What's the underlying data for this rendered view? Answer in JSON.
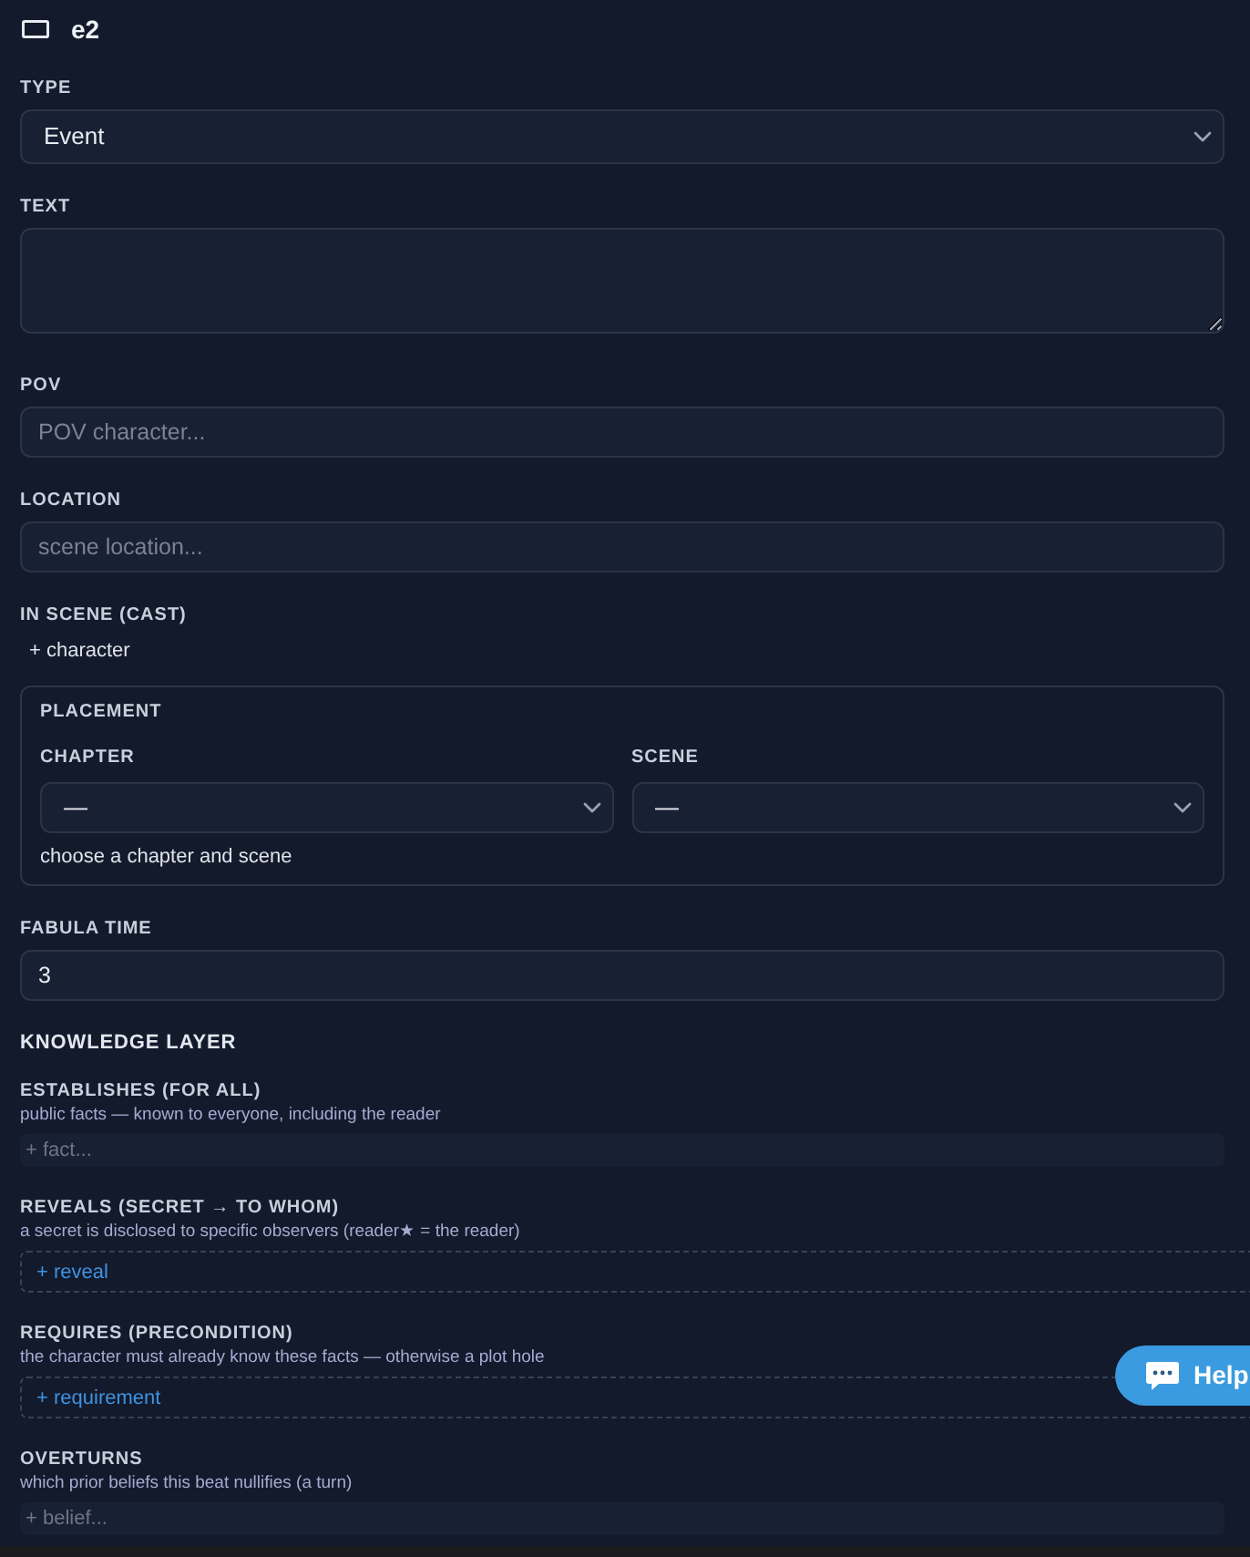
{
  "header": {
    "title": "e2"
  },
  "fields": [
    {
      "kind": "select",
      "label": "TYPE",
      "value": "Event"
    },
    {
      "kind": "textarea",
      "label": "TEXT"
    },
    {
      "kind": "input",
      "label": "POV",
      "placeholder": "POV character..."
    },
    {
      "kind": "input",
      "label": "LOCATION",
      "placeholder": "scene location..."
    },
    {
      "kind": "add",
      "label": "IN SCENE (CAST)",
      "action": "+ character"
    }
  ],
  "placement": {
    "title": "PLACEMENT",
    "selects": [
      {
        "label": "CHAPTER",
        "value": "—"
      },
      {
        "label": "SCENE",
        "value": "—"
      }
    ],
    "hint": "choose a chapter and scene"
  },
  "fabula_time": {
    "label": "FABULA TIME",
    "value": "3"
  },
  "knowledge_layer": {
    "title": "KNOWLEDGE LAYER",
    "sections": [
      {
        "kind": "input",
        "label": "ESTABLISHES (FOR ALL)",
        "description": "public facts — known to everyone, including the reader",
        "placeholder": "+ fact..."
      },
      {
        "kind": "add",
        "label": "REVEALS (SECRET → TO WHOM)",
        "description": "a secret is disclosed to specific observers (reader★ = the reader)",
        "action": "+ reveal"
      },
      {
        "kind": "add",
        "label": "REQUIRES (PRECONDITION)",
        "description": "the character must already know these facts — otherwise a plot hole",
        "action": "+ requirement"
      },
      {
        "kind": "input",
        "label": "OVERTURNS",
        "description": "which prior beliefs this beat nullifies (a turn)",
        "placeholder": "+ belief..."
      }
    ]
  },
  "help_button": {
    "label": "Help"
  }
}
